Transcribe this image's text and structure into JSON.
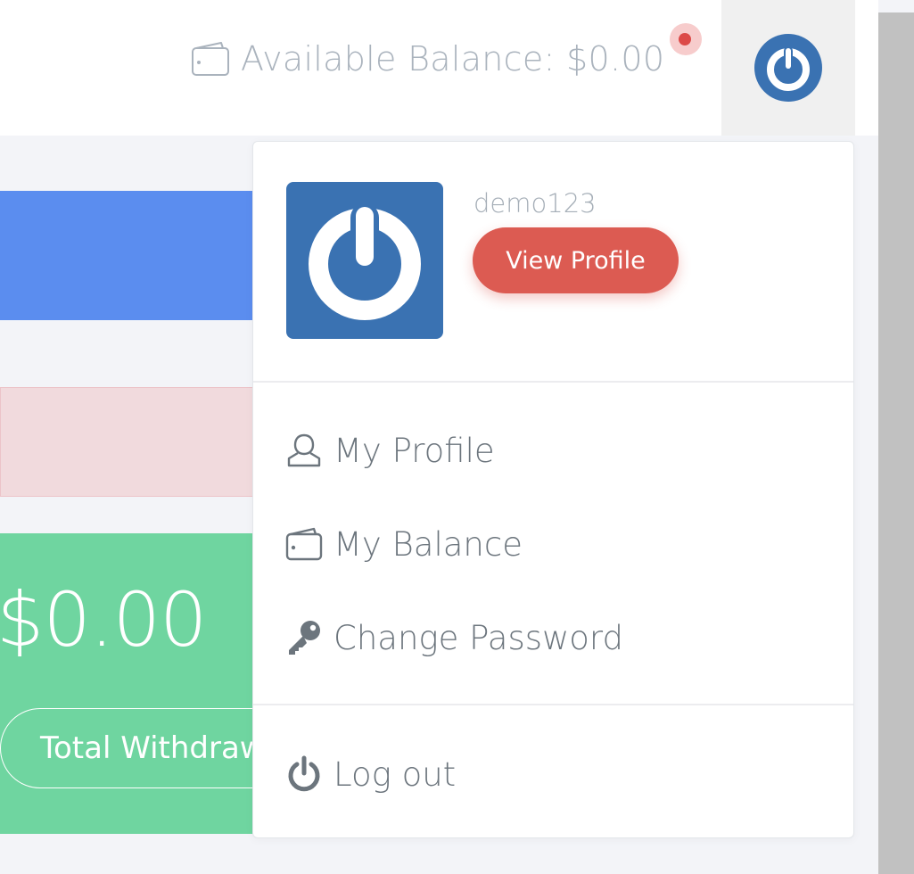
{
  "header": {
    "balance_label": "Available Balance: $0.00",
    "wallet_icon": "wallet-icon",
    "notification_icon": "notification-dot-icon",
    "avatar_icon": "power-logo-icon"
  },
  "cards": {
    "green_amount": "$0.00",
    "withdraw_button_label": "Total Withdraw"
  },
  "dropdown": {
    "username": "demo123",
    "view_profile_label": "View Profile",
    "items": [
      {
        "label": "My Profile",
        "icon": "user-icon"
      },
      {
        "label": "My Balance",
        "icon": "wallet-icon"
      },
      {
        "label": "Change Password",
        "icon": "key-icon"
      }
    ],
    "logout": {
      "label": "Log out",
      "icon": "power-icon"
    }
  },
  "colors": {
    "brand_blue": "#3a72b2",
    "view_profile_red": "#dc5b52",
    "card_blue": "#5b8def",
    "card_pink": "#f1dadd",
    "card_green": "#6fd5a0",
    "notification_red": "#dc4a48"
  }
}
